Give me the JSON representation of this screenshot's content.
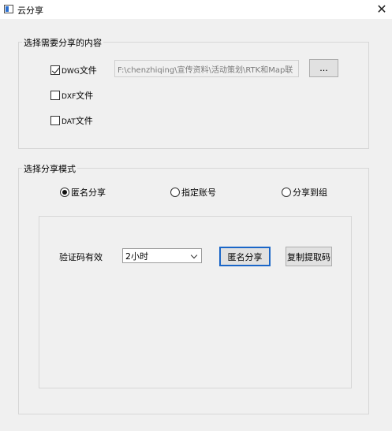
{
  "window": {
    "title": "云分享",
    "close_glyph": "✕",
    "app_icon": "app-window-icon"
  },
  "content_group": {
    "label": "选择需要分享的内容",
    "dwg": {
      "prefix": "DWG",
      "suffix": "文件",
      "checked": true
    },
    "dxf": {
      "prefix": "DXF",
      "suffix": "文件",
      "checked": false
    },
    "dat": {
      "prefix": "DAT",
      "suffix": "文件",
      "checked": false
    },
    "path_value": "F:\\chenzhiqing\\宣传资料\\活动策划\\RTK和Map联",
    "browse_label": "..."
  },
  "mode_group": {
    "label": "选择分享模式",
    "options": [
      {
        "label": "匿名分享",
        "selected": true
      },
      {
        "label": "指定账号",
        "selected": false
      },
      {
        "label": "分享到组",
        "selected": false
      }
    ],
    "validity_label": "验证码有效",
    "validity_value": "2小时",
    "anon_share_button": "匿名分享",
    "copy_code_button": "复制提取码"
  }
}
